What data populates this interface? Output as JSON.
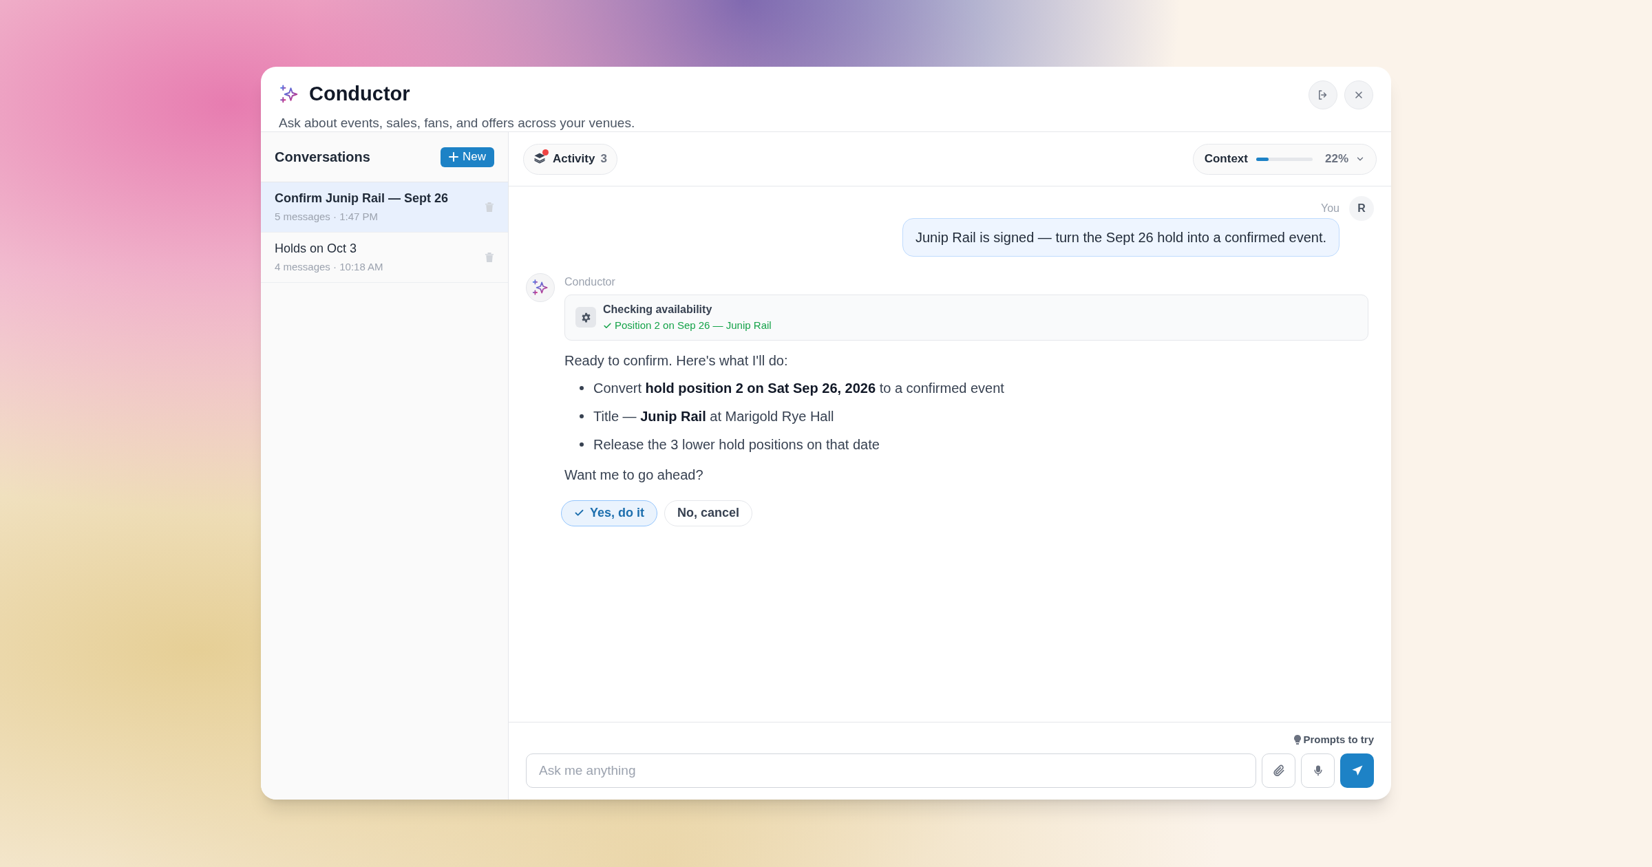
{
  "header": {
    "title": "Conductor",
    "subtitle": "Ask about events, sales, fans, and offers across your venues."
  },
  "sidebar": {
    "title": "Conversations",
    "new_button": "New",
    "items": [
      {
        "title": "Confirm Junip Rail — Sept 26",
        "meta": "5 messages · 1:47 PM",
        "selected": true
      },
      {
        "title": "Holds on Oct 3",
        "meta": "4 messages · 10:18 AM",
        "selected": false
      }
    ]
  },
  "toolbar": {
    "activity": {
      "label": "Activity",
      "count": "3",
      "unread": true
    },
    "context": {
      "label": "Context",
      "level": 0.22,
      "reading": "22%"
    }
  },
  "messages": [
    {
      "kind": "user",
      "author": "You",
      "avatar": "R",
      "text": "Junip Rail is signed — turn the Sept 26 hold into a confirmed event."
    },
    {
      "kind": "assistant",
      "author": "Conductor",
      "tool": {
        "title": "Checking availability",
        "result": "Position 2 on Sep 26 — Junip Rail",
        "done": true
      },
      "intro": "Ready to confirm. Here's what I'll do:",
      "bullets": [
        "Convert **hold position 2 on Sat Sep 26, 2026** to a confirmed event",
        "Title — **Junip Rail** at Marigold Rye Hall",
        "Release the 3 lower hold positions on that date"
      ],
      "outro": "Want me to go ahead?",
      "actions": [
        {
          "label": "Yes, do it",
          "kind": "primary"
        },
        {
          "label": "No, cancel",
          "kind": "secondary"
        }
      ]
    }
  ],
  "composer": {
    "prompts_link": "Prompts to try",
    "placeholder": "Ask me anything"
  }
}
